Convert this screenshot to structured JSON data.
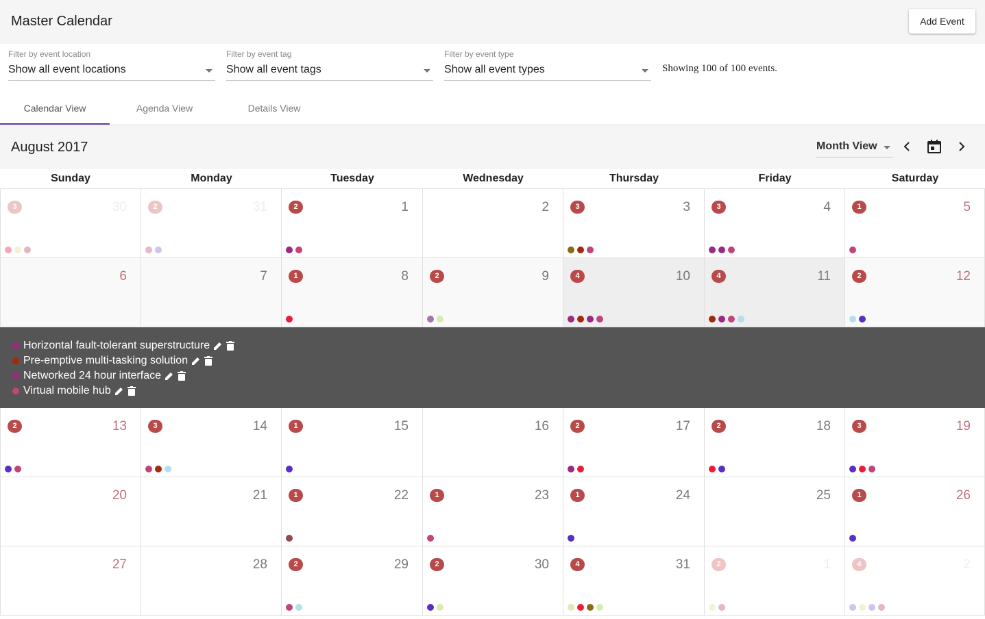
{
  "app": {
    "title": "Master Calendar",
    "add_event_label": "Add Event"
  },
  "filters": [
    {
      "label": "Filter by event location",
      "value": "Show all event locations"
    },
    {
      "label": "Filter by event tag",
      "value": "Show all event tags"
    },
    {
      "label": "Filter by event type",
      "value": "Show all event types"
    }
  ],
  "showing_text": "Showing 100 of 100 events.",
  "tabs": [
    {
      "label": "Calendar View",
      "active": true
    },
    {
      "label": "Agenda View",
      "active": false
    },
    {
      "label": "Details View",
      "active": false
    }
  ],
  "calendar": {
    "month_title": "August 2017",
    "view_mode": "Month View",
    "day_names": [
      "Sunday",
      "Monday",
      "Tuesday",
      "Wednesday",
      "Thursday",
      "Friday",
      "Saturday"
    ],
    "weeks": [
      [
        {
          "day": "30",
          "count": "3",
          "faded": true,
          "dots": [
            "#f4a7b9",
            "#f1f3d2",
            "#e3b7c6"
          ]
        },
        {
          "day": "31",
          "count": "2",
          "faded": true,
          "dots": [
            "#e5b9cd",
            "#cfc4ee"
          ]
        },
        {
          "day": "1",
          "count": "2",
          "dots": [
            "#9c2a83",
            "#c2447a"
          ]
        },
        {
          "day": "2",
          "count": "",
          "dots": []
        },
        {
          "day": "3",
          "count": "3",
          "dots": [
            "#8a6a12",
            "#a12a0c",
            "#c2447a"
          ]
        },
        {
          "day": "4",
          "count": "3",
          "dots": [
            "#9c2a83",
            "#9c2a83",
            "#c2447a"
          ]
        },
        {
          "day": "5",
          "count": "1",
          "dots": [
            "#c2447a"
          ]
        }
      ],
      [
        {
          "day": "6",
          "count": "",
          "dots": []
        },
        {
          "day": "7",
          "count": "",
          "dots": []
        },
        {
          "day": "8",
          "count": "1",
          "dots": [
            "#ee1a3a"
          ]
        },
        {
          "day": "9",
          "count": "2",
          "dots": [
            "#9e7aa4",
            "#d9ecb0"
          ]
        },
        {
          "day": "10",
          "count": "4",
          "selected": true,
          "dots": [
            "#9c2a83",
            "#a12a0c",
            "#9c2a83",
            "#c2447a"
          ]
        },
        {
          "day": "11",
          "count": "4",
          "selected": true,
          "dots": [
            "#a12a0c",
            "#9c2a83",
            "#c2447a",
            "#b3e0ea"
          ]
        },
        {
          "day": "12",
          "count": "2",
          "dots": [
            "#b3e0ea",
            "#5a2ec6"
          ]
        }
      ],
      [
        {
          "day": "13",
          "count": "2",
          "dots": [
            "#5a2ec6",
            "#c2447a"
          ]
        },
        {
          "day": "14",
          "count": "3",
          "dots": [
            "#c2447a",
            "#a12a0c",
            "#b3e0ea"
          ]
        },
        {
          "day": "15",
          "count": "1",
          "dots": [
            "#5a2ec6"
          ]
        },
        {
          "day": "16",
          "count": "",
          "dots": []
        },
        {
          "day": "17",
          "count": "2",
          "dots": [
            "#9c2a83",
            "#ee1a3a"
          ]
        },
        {
          "day": "18",
          "count": "2",
          "dots": [
            "#ee1a3a",
            "#5a2ec6"
          ]
        },
        {
          "day": "19",
          "count": "3",
          "dots": [
            "#5a2ec6",
            "#ee1a3a",
            "#c2447a"
          ]
        }
      ],
      [
        {
          "day": "20",
          "count": "",
          "dots": []
        },
        {
          "day": "21",
          "count": "",
          "dots": []
        },
        {
          "day": "22",
          "count": "1",
          "dots": [
            "#95494b"
          ]
        },
        {
          "day": "23",
          "count": "1",
          "dots": [
            "#c2447a"
          ]
        },
        {
          "day": "24",
          "count": "1",
          "dots": [
            "#5a2ec6"
          ]
        },
        {
          "day": "25",
          "count": "",
          "dots": []
        },
        {
          "day": "26",
          "count": "1",
          "dots": [
            "#5a2ec6"
          ]
        }
      ],
      [
        {
          "day": "27",
          "count": "",
          "dots": []
        },
        {
          "day": "28",
          "count": "",
          "dots": []
        },
        {
          "day": "29",
          "count": "2",
          "dots": [
            "#c2447a",
            "#b3e0ea"
          ]
        },
        {
          "day": "30",
          "count": "2",
          "dots": [
            "#5a2ec6",
            "#d9ecb0"
          ]
        },
        {
          "day": "31",
          "count": "4",
          "dots": [
            "#d9ecb0",
            "#ee1a3a",
            "#8a6a12",
            "#d9ecb0"
          ]
        },
        {
          "day": "1",
          "count": "2",
          "faded": true,
          "dots": [
            "#f1f3d2",
            "#e3b7c6"
          ]
        },
        {
          "day": "2",
          "count": "4",
          "faded": true,
          "dots": [
            "#cfc4ee",
            "#f1f3d2",
            "#cfc4ee",
            "#e3b7c6"
          ]
        }
      ]
    ],
    "expanded_events": [
      {
        "title": "Horizontal fault-tolerant superstructure",
        "color": "#9c2a83"
      },
      {
        "title": "Pre-emptive multi-tasking solution",
        "color": "#a12a0c"
      },
      {
        "title": "Networked 24 hour interface",
        "color": "#9c2a83"
      },
      {
        "title": "Virtual mobile hub",
        "color": "#c2447a"
      }
    ]
  }
}
